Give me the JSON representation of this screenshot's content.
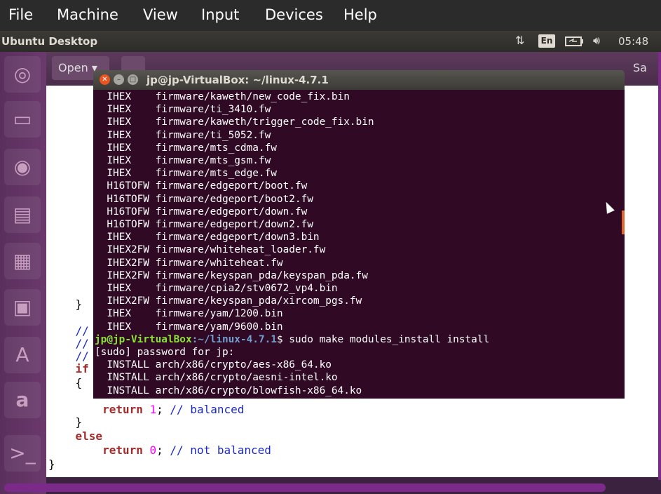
{
  "host_menu": [
    "File",
    "Machine",
    "View",
    "Input",
    "Devices",
    "Help"
  ],
  "panel": {
    "title": "Ubuntu Desktop",
    "keyboard_layout": "En",
    "time": "05:48"
  },
  "editor": {
    "open_label": "Open",
    "save_label": "Sa",
    "code_lines": [
      "    }",
      "",
      "    //",
      "    //",
      "    //",
      "    if",
      "    {",
      "        return 1; // balanced",
      "    }",
      "    else",
      "        return 0; // not balanced",
      "}"
    ]
  },
  "terminal": {
    "title": "jp@jp-VirtualBox: ~/linux-4.7.1",
    "output_lines": [
      "  IHEX    firmware/kaweth/new_code_fix.bin",
      "  IHEX    firmware/ti_3410.fw",
      "  IHEX    firmware/kaweth/trigger_code_fix.bin",
      "  IHEX    firmware/ti_5052.fw",
      "  IHEX    firmware/mts_cdma.fw",
      "  IHEX    firmware/mts_gsm.fw",
      "  IHEX    firmware/mts_edge.fw",
      "  H16TOFW firmware/edgeport/boot.fw",
      "  H16TOFW firmware/edgeport/boot2.fw",
      "  H16TOFW firmware/edgeport/down.fw",
      "  H16TOFW firmware/edgeport/down2.fw",
      "  IHEX    firmware/edgeport/down3.bin",
      "  IHEX2FW firmware/whiteheat_loader.fw",
      "  IHEX2FW firmware/whiteheat.fw",
      "  IHEX2FW firmware/keyspan_pda/keyspan_pda.fw",
      "  IHEX    firmware/cpia2/stv0672_vp4.bin",
      "  IHEX2FW firmware/keyspan_pda/xircom_pgs.fw",
      "  IHEX    firmware/yam/1200.bin",
      "  IHEX    firmware/yam/9600.bin"
    ],
    "prompt_user": "jp@jp-VirtualBox",
    "prompt_path": ":~/linux-4.7.1",
    "prompt_command": "$ sudo make modules_install install",
    "after_lines": [
      "[sudo] password for jp:",
      "  INSTALL arch/x86/crypto/aes-x86_64.ko",
      "  INSTALL arch/x86/crypto/aesni-intel.ko",
      "  INSTALL arch/x86/crypto/blowfish-x86_64.ko"
    ]
  },
  "icons": {
    "launcher": [
      "ubuntu-dash-icon",
      "files-icon",
      "firefox-icon",
      "writer-icon",
      "calc-icon",
      "impress-icon",
      "software-center-icon",
      "amazon-icon",
      "terminal-icon"
    ]
  }
}
